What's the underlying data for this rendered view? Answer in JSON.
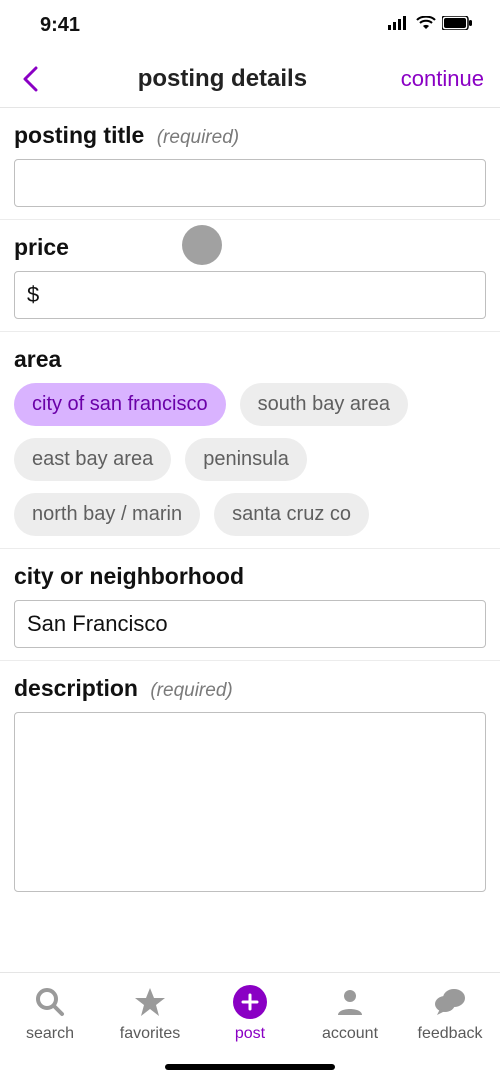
{
  "status": {
    "time": "9:41"
  },
  "header": {
    "title": "posting details",
    "continue": "continue"
  },
  "fields": {
    "title": {
      "label": "posting title",
      "hint": "(required)",
      "value": ""
    },
    "price": {
      "label": "price",
      "prefix": "$",
      "value": "$"
    },
    "area": {
      "label": "area"
    },
    "city": {
      "label": "city or neighborhood",
      "value": "San Francisco"
    },
    "desc": {
      "label": "description",
      "hint": "(required)",
      "value": ""
    }
  },
  "areas": [
    {
      "label": "city of san francisco",
      "selected": true
    },
    {
      "label": "south bay area",
      "selected": false
    },
    {
      "label": "east bay area",
      "selected": false
    },
    {
      "label": "peninsula",
      "selected": false
    },
    {
      "label": "north bay / marin",
      "selected": false
    },
    {
      "label": "santa cruz co",
      "selected": false
    }
  ],
  "tabs": {
    "search": "search",
    "favorites": "favorites",
    "post": "post",
    "account": "account",
    "feedback": "feedback"
  }
}
